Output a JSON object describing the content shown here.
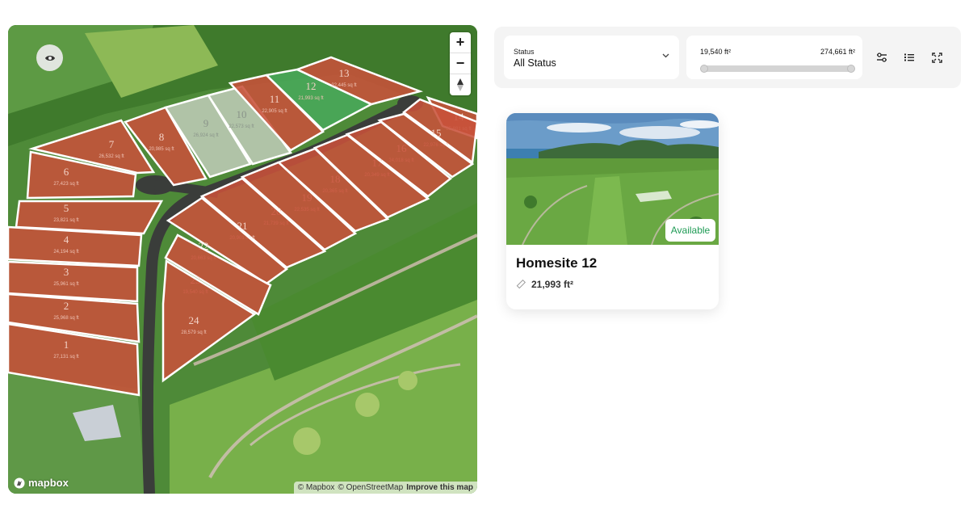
{
  "map": {
    "lots": [
      {
        "number": "1",
        "area": "27,131 sq ft",
        "status": "sold"
      },
      {
        "number": "2",
        "area": "25,968 sq ft",
        "status": "sold"
      },
      {
        "number": "3",
        "area": "25,961 sq ft",
        "status": "sold"
      },
      {
        "number": "4",
        "area": "24,194 sq ft",
        "status": "sold"
      },
      {
        "number": "5",
        "area": "23,821 sq ft",
        "status": "sold"
      },
      {
        "number": "6",
        "area": "27,423 sq ft",
        "status": "sold"
      },
      {
        "number": "7",
        "area": "26,532 sq ft",
        "status": "sold"
      },
      {
        "number": "8",
        "area": "20,985 sq ft",
        "status": "sold"
      },
      {
        "number": "9",
        "area": "26,924 sq ft",
        "status": "reserved"
      },
      {
        "number": "10",
        "area": "22,573 sq ft",
        "status": "reserved"
      },
      {
        "number": "11",
        "area": "22,905 sq ft",
        "status": "sold"
      },
      {
        "number": "12",
        "area": "21,993 sq ft",
        "status": "available"
      },
      {
        "number": "13",
        "area": "22,445 sq ft",
        "status": "sold"
      },
      {
        "number": "14",
        "area": "25,881 sq ft",
        "status": "sold"
      },
      {
        "number": "15",
        "area": "22,976 sq ft",
        "status": "sold"
      },
      {
        "number": "16",
        "area": "24,018 sq ft",
        "status": "sold"
      },
      {
        "number": "17",
        "area": "20,349 sq ft",
        "status": "sold"
      },
      {
        "number": "18",
        "area": "20,365 sq ft",
        "status": "sold"
      },
      {
        "number": "19",
        "area": "22,535 sq ft",
        "status": "sold"
      },
      {
        "number": "20",
        "area": "21,739 sq ft",
        "status": "sold"
      },
      {
        "number": "21",
        "area": "20,901 sq ft",
        "status": "sold"
      },
      {
        "number": "22",
        "area": "20,663 sq ft",
        "status": "sold"
      },
      {
        "number": "23",
        "area": "19,540 sq ft",
        "status": "sold"
      },
      {
        "number": "24",
        "area": "28,579 sq ft",
        "status": "sold"
      }
    ],
    "controls": {
      "zoom_in": "+",
      "zoom_out": "−"
    },
    "logo_text": "mapbox",
    "attribution": {
      "mapbox": "© Mapbox",
      "osm": "© OpenStreetMap",
      "improve": "Improve this map"
    },
    "colors": {
      "sold": "#c8513a",
      "available": "#49a85a",
      "reserved": "#c9d1c3"
    }
  },
  "filters": {
    "status_label": "Status",
    "status_value": "All Status",
    "area_min": "19,540 ft²",
    "area_max": "274,661 ft²",
    "range_selected": [
      0,
      1
    ]
  },
  "listing": {
    "badge": "Available",
    "title": "Homesite 12",
    "area": "21,993 ft²"
  },
  "icons": [
    "eye-icon",
    "compass-icon",
    "chevron-down-icon",
    "sliders-icon",
    "list-icon",
    "fullscreen-icon",
    "ruler-icon",
    "mapbox-logo-icon"
  ]
}
